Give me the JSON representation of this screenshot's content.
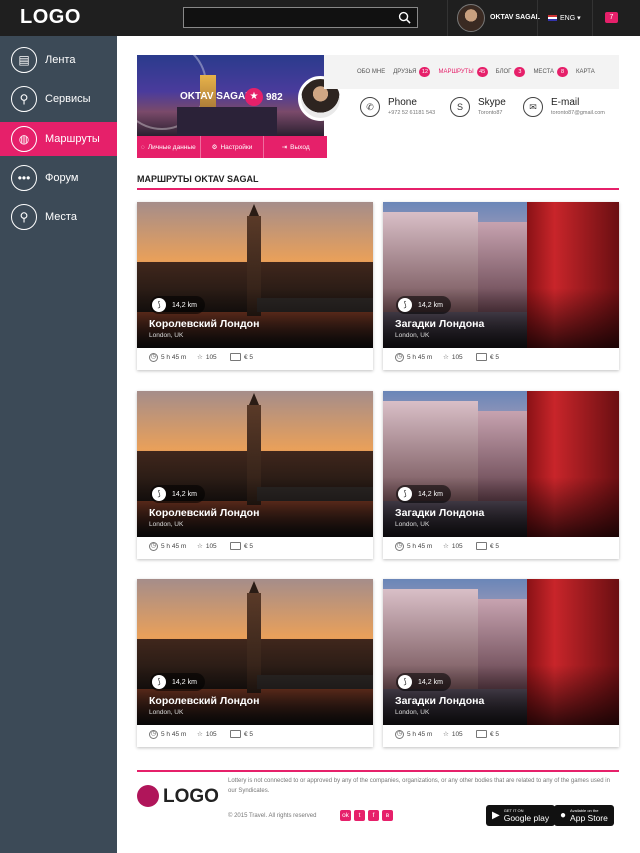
{
  "header": {
    "logo": "LOGO",
    "search_placeholder": "",
    "user_name": "OKTAV SAGAL",
    "language": "ENG",
    "notifications": "7"
  },
  "sidebar": {
    "items": [
      {
        "label": "Лента",
        "icon": "document-icon"
      },
      {
        "label": "Сервисы",
        "icon": "sitemap-icon"
      },
      {
        "label": "Маршруты",
        "icon": "globe-icon",
        "active": true
      },
      {
        "label": "Форум",
        "icon": "chat-icon"
      },
      {
        "label": "Места",
        "icon": "location-pin-icon"
      }
    ]
  },
  "profile": {
    "name": "OKTAV SAGAL",
    "score": "982",
    "actions": [
      "Личные данные",
      "Настройки",
      "Выход"
    ],
    "tabs": [
      {
        "label": "ОБО МНЕ",
        "count": ""
      },
      {
        "label": "ДРУЗЬЯ",
        "count": "12"
      },
      {
        "label": "МАРШРУТЫ",
        "count": "45"
      },
      {
        "label": "БЛОГ",
        "count": "3"
      },
      {
        "label": "МЕСТА",
        "count": "8"
      },
      {
        "label": "КАРТА",
        "count": ""
      }
    ],
    "contacts": [
      {
        "title": "Phone",
        "value": "+972 52 61181 543"
      },
      {
        "title": "Skype",
        "value": "Toronto87"
      },
      {
        "title": "E-mail",
        "value": "toronto87@gmail.com"
      }
    ]
  },
  "section": {
    "title": "МАРШРУТЫ OKTAV SAGAL"
  },
  "cards": [
    {
      "title": "Королевский Лондон",
      "location": "London, UK",
      "distance": "14,2 km",
      "time": "5 h 45 m",
      "likes": "105",
      "price": "€ 5"
    },
    {
      "title": "Загадки Лондона",
      "location": "London, UK",
      "distance": "14,2 km",
      "time": "5 h 45 m",
      "likes": "105",
      "price": "€ 5"
    },
    {
      "title": "Королевский Лондон",
      "location": "London, UK",
      "distance": "14,2 km",
      "time": "5 h 45 m",
      "likes": "105",
      "price": "€ 5"
    },
    {
      "title": "Загадки Лондона",
      "location": "London, UK",
      "distance": "14,2 km",
      "time": "5 h 45 m",
      "likes": "105",
      "price": "€ 5"
    },
    {
      "title": "Королевский Лондон",
      "location": "London, UK",
      "distance": "14,2 km",
      "time": "5 h 45 m",
      "likes": "105",
      "price": "€ 5"
    },
    {
      "title": "Загадки Лондона",
      "location": "London, UK",
      "distance": "14,2 km",
      "time": "5 h 45 m",
      "likes": "105",
      "price": "€ 5"
    }
  ],
  "footer": {
    "logo": "LOGO",
    "disclaimer": "Lottery is not connected to or approved by any of the companies, organizations, or any other bodies that are related to any of the games used in our Syndicates.",
    "copyright": "© 2015 Travel. All rights reserved",
    "social": [
      "ok",
      "tw",
      "fb",
      "vk"
    ],
    "google_small": "GET IT ON",
    "google_big": "Google play",
    "apple_small": "Available on the",
    "apple_big": "App Store"
  },
  "colors": {
    "accent": "#e6206a",
    "sidebar": "#3c4a57",
    "topbar": "#1f1f1f"
  }
}
